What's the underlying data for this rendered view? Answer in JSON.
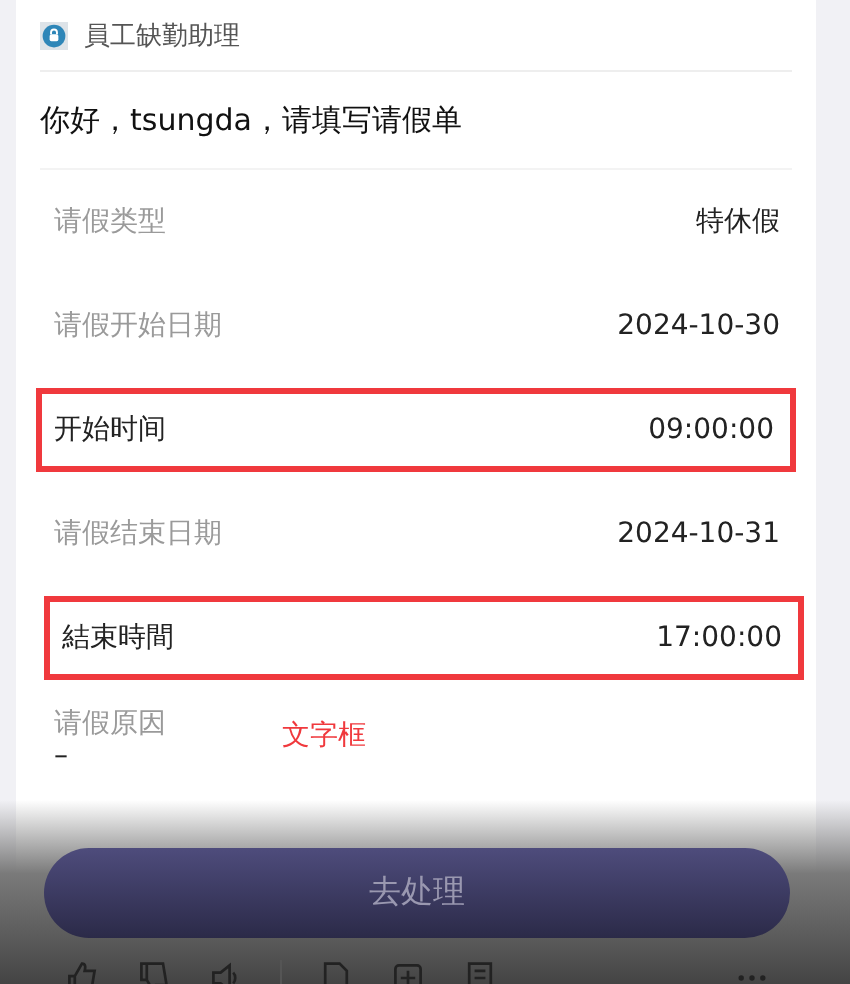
{
  "header": {
    "title": "員工缺勤助理"
  },
  "greeting": "你好，tsungda，请填写请假单",
  "fields": [
    {
      "kind": "plain",
      "label": "请假类型",
      "value": "特休假"
    },
    {
      "kind": "plain",
      "label": "请假开始日期",
      "value": "2024-10-30"
    },
    {
      "kind": "highlighted",
      "label": "开始时间",
      "value": "09:00:00"
    },
    {
      "kind": "plain",
      "label": "请假结束日期",
      "value": "2024-10-31"
    },
    {
      "kind": "highlighted",
      "label": "結束時間",
      "value": "17:00:00"
    }
  ],
  "reason": {
    "label": "请假原因",
    "value": "–",
    "annotation": "文字框"
  },
  "submit_button": "去处理"
}
